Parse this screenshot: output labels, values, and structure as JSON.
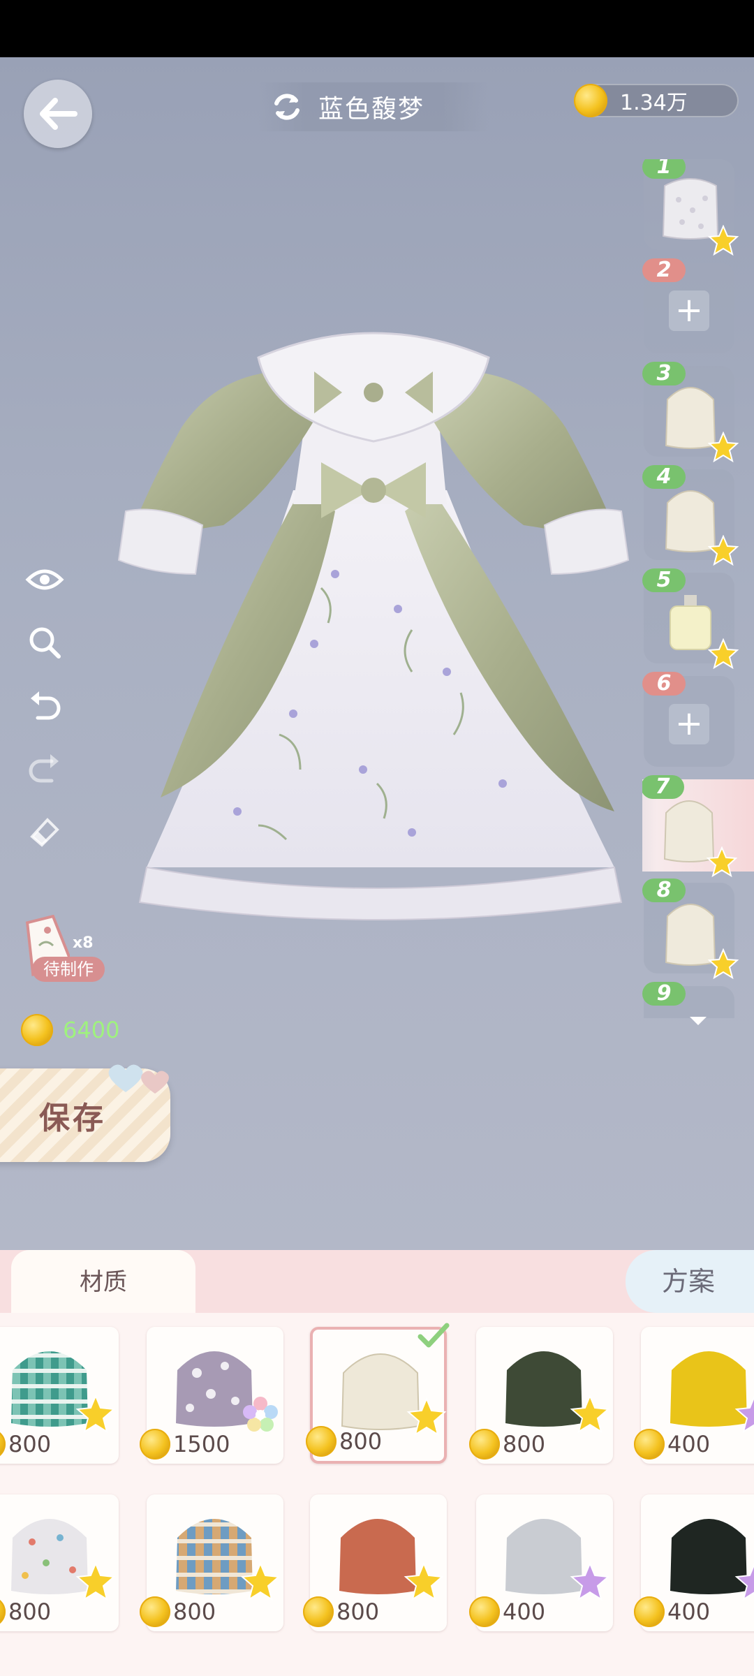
{
  "header": {
    "title": "蓝色馥梦",
    "currency": "1.34万"
  },
  "slots": [
    {
      "num": "1",
      "state": "filled",
      "item": "lace-top",
      "star": "yellow"
    },
    {
      "num": "2",
      "state": "empty"
    },
    {
      "num": "3",
      "state": "filled",
      "item": "cream-fabric",
      "star": "yellow"
    },
    {
      "num": "4",
      "state": "filled",
      "item": "cream-fabric",
      "star": "yellow"
    },
    {
      "num": "5",
      "state": "filled",
      "item": "perfume-bottle",
      "star": "yellow"
    },
    {
      "num": "6",
      "state": "empty"
    },
    {
      "num": "7",
      "state": "selected",
      "item": "cream-fabric",
      "star": "yellow"
    },
    {
      "num": "8",
      "state": "filled",
      "item": "cream-fabric",
      "star": "yellow"
    },
    {
      "num": "9",
      "state": "partial"
    }
  ],
  "pending": {
    "count": "x8",
    "label": "待制作"
  },
  "cost": {
    "value": "6400"
  },
  "save": {
    "label": "保存"
  },
  "tabs": {
    "material": "材质",
    "plan": "方案"
  },
  "materials": [
    {
      "price": "800",
      "pattern": "green-plaid",
      "star": "yellow"
    },
    {
      "price": "1500",
      "pattern": "purple-floral",
      "star": "rainbow"
    },
    {
      "price": "800",
      "pattern": "cream-silk",
      "star": "yellow",
      "selected": true
    },
    {
      "price": "800",
      "pattern": "dark-olive",
      "star": "yellow"
    },
    {
      "price": "400",
      "pattern": "gold-satin",
      "star": "purple"
    },
    {
      "price": "800",
      "pattern": "polka-dot",
      "star": "yellow"
    },
    {
      "price": "800",
      "pattern": "blue-plaid",
      "star": "yellow"
    },
    {
      "price": "800",
      "pattern": "terracotta",
      "star": "yellow"
    },
    {
      "price": "400",
      "pattern": "silver-satin",
      "star": "purple"
    },
    {
      "price": "400",
      "pattern": "black-satin",
      "star": "purple"
    }
  ],
  "colors": {
    "accent_pink": "#f8dfe0",
    "price_green": "#9ff27e",
    "slot_green": "#79c26e",
    "slot_red": "#e18f8a"
  }
}
